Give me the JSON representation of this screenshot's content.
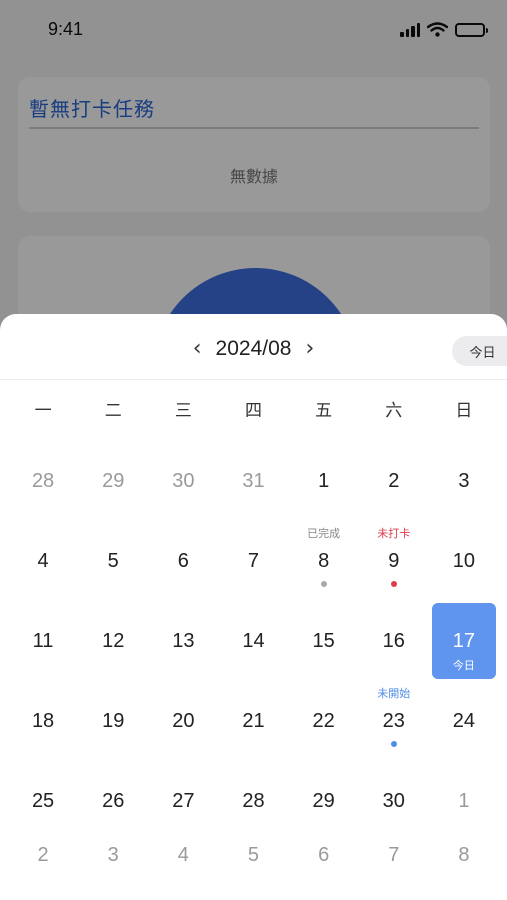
{
  "status_bar": {
    "time": "9:41"
  },
  "background": {
    "task_card": {
      "title": "暫無打卡任務",
      "empty_text": "無數據"
    }
  },
  "calendar": {
    "month_label": "2024/08",
    "today_button": "今日",
    "weekdays": [
      "一",
      "二",
      "三",
      "四",
      "五",
      "六",
      "日"
    ],
    "days": [
      {
        "day": "28",
        "other": true
      },
      {
        "day": "29",
        "other": true
      },
      {
        "day": "30",
        "other": true
      },
      {
        "day": "31",
        "other": true
      },
      {
        "day": "1"
      },
      {
        "day": "2"
      },
      {
        "day": "3"
      },
      {
        "day": "4"
      },
      {
        "day": "5"
      },
      {
        "day": "6"
      },
      {
        "day": "7"
      },
      {
        "day": "8",
        "status": "已完成",
        "status_color": "gray"
      },
      {
        "day": "9",
        "status": "未打卡",
        "status_color": "red"
      },
      {
        "day": "10"
      },
      {
        "day": "11"
      },
      {
        "day": "12"
      },
      {
        "day": "13"
      },
      {
        "day": "14"
      },
      {
        "day": "15"
      },
      {
        "day": "16"
      },
      {
        "day": "17",
        "today": true,
        "tag": "今日"
      },
      {
        "day": "18"
      },
      {
        "day": "19"
      },
      {
        "day": "20"
      },
      {
        "day": "21"
      },
      {
        "day": "22"
      },
      {
        "day": "23",
        "status": "未開始",
        "status_color": "blue"
      },
      {
        "day": "24"
      },
      {
        "day": "25"
      },
      {
        "day": "26"
      },
      {
        "day": "27"
      },
      {
        "day": "28"
      },
      {
        "day": "29"
      },
      {
        "day": "30"
      },
      {
        "day": "1",
        "other": true
      },
      {
        "day": "2",
        "other": true
      },
      {
        "day": "3",
        "other": true
      },
      {
        "day": "4",
        "other": true
      },
      {
        "day": "5",
        "other": true
      },
      {
        "day": "6",
        "other": true
      },
      {
        "day": "7",
        "other": true
      },
      {
        "day": "8",
        "other": true
      }
    ]
  },
  "icons": {
    "prev": "chevron-left-icon",
    "next": "chevron-right-icon",
    "signal": "signal-icon",
    "wifi": "wifi-icon",
    "battery": "battery-icon"
  },
  "colors": {
    "accent": "#5f95ef",
    "title_blue": "#2a66d6",
    "missed_red": "#e03a4c",
    "pending_blue": "#4f8ee8",
    "done_gray": "#a9a9a9"
  }
}
